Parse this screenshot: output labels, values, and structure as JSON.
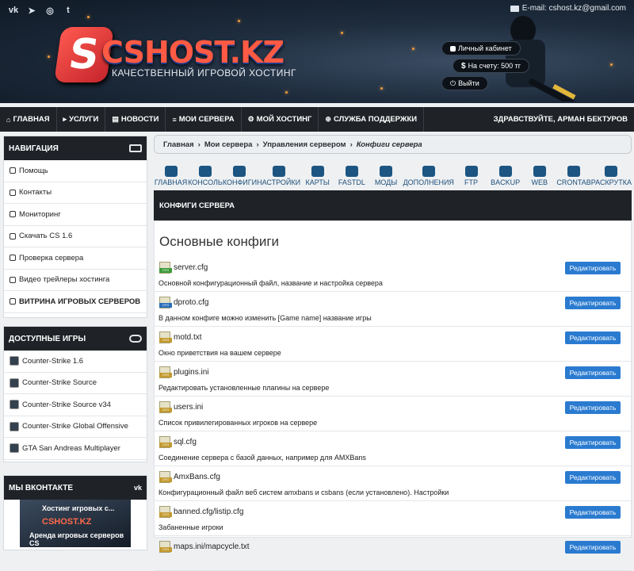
{
  "header": {
    "email": "E-mail: cshost.kz@gmail.com",
    "logo_text": "CSHOST.KZ",
    "logo_letter": "S",
    "tagline": "КАЧЕСТВЕННЫЙ ИГРОВОЙ ХОСТИНГ",
    "account": {
      "cabinet": "Личный кабинет",
      "balance": "На счету: 500 тг",
      "logout": "Выйти"
    },
    "social": [
      {
        "icon": "vk-icon",
        "glyph": "vk"
      },
      {
        "icon": "telegram-icon",
        "glyph": "➤"
      },
      {
        "icon": "instagram-icon",
        "glyph": "◎"
      },
      {
        "icon": "tumblr-icon",
        "glyph": "t"
      }
    ]
  },
  "nav": {
    "items": [
      {
        "label": "ГЛАВНАЯ",
        "icon": "home-icon",
        "glyph": "⌂"
      },
      {
        "label": "УСЛУГИ",
        "icon": "cart-icon",
        "glyph": "▸"
      },
      {
        "label": "НОВОСТИ",
        "icon": "newspaper-icon",
        "glyph": "▤"
      },
      {
        "label": "МОИ СЕРВЕРА",
        "icon": "list-icon",
        "glyph": "≡"
      },
      {
        "label": "МОЙ ХОСТИНГ",
        "icon": "cogs-icon",
        "glyph": "⚙"
      },
      {
        "label": "СЛУЖБА ПОДДЕРЖКИ",
        "icon": "lifebuoy-icon",
        "glyph": "⊕"
      }
    ],
    "greeting": "ЗДРАВСТВУЙТЕ, АРМАН БЕКТУРОВ"
  },
  "sidebar": {
    "nav_title": "НАВИГАЦИЯ",
    "nav_items": [
      {
        "label": "Помощь",
        "icon": "question-icon"
      },
      {
        "label": "Контакты",
        "icon": "phone-icon"
      },
      {
        "label": "Мониторинг",
        "icon": "monitor-icon"
      },
      {
        "label": "Скачать CS 1.6",
        "icon": "download-icon"
      },
      {
        "label": "Проверка сервера",
        "icon": "power-icon"
      },
      {
        "label": "Видео трейлеры хостинга",
        "icon": "video-icon"
      },
      {
        "label": "ВИТРИНА ИГРОВЫХ СЕРВЕРОВ",
        "icon": "gamepad-icon"
      }
    ],
    "games_title": "ДОСТУПНЫЕ ИГРЫ",
    "games": [
      {
        "label": "Counter-Strike 1.6",
        "icon": "cs16-icon"
      },
      {
        "label": "Counter-Strike Source",
        "icon": "css-icon"
      },
      {
        "label": "Counter-Strike Source v34",
        "icon": "css-v34-icon"
      },
      {
        "label": "Counter-Strike Global Offensive",
        "icon": "csgo-icon"
      },
      {
        "label": "GTA San Andreas Multiplayer",
        "icon": "samp-icon"
      }
    ],
    "vk_title": "МЫ ВКОНТАКТЕ",
    "vk_widget": {
      "title": "Хостинг игровых с...",
      "brand": "CSHOST.KZ",
      "subtitle": "Аренда игровых серверов CS"
    }
  },
  "main": {
    "breadcrumb": [
      "Главная",
      "Мои сервера",
      "Управления сервером"
    ],
    "breadcrumb_current": "Конфиги сервера",
    "tools": [
      {
        "label": "ГЛАВНАЯ",
        "icon": "home-icon"
      },
      {
        "label": "КОНСОЛЬ",
        "icon": "console-icon"
      },
      {
        "label": "КОНФИГИ",
        "icon": "configs-icon"
      },
      {
        "label": "НАСТРОЙКИ",
        "icon": "settings-icon"
      },
      {
        "label": "КАРТЫ",
        "icon": "maps-icon"
      },
      {
        "label": "FASTDL",
        "icon": "cloud-download-icon"
      },
      {
        "label": "МОДЫ",
        "icon": "mods-icon"
      },
      {
        "label": "ДОПОЛНЕНИЯ",
        "icon": "addons-icon"
      },
      {
        "label": "FTP",
        "icon": "folder-icon"
      },
      {
        "label": "BACKUP",
        "icon": "backup-icon"
      },
      {
        "label": "WEB",
        "icon": "globe-icon"
      },
      {
        "label": "CRONTAB",
        "icon": "clock-icon"
      },
      {
        "label": "РАСКРУТКА",
        "icon": "chart-icon"
      }
    ],
    "section_title": "КОНФИГИ СЕРВЕРА",
    "configs_title": "Основные конфиги",
    "edit_label": "Редактировать",
    "configs": [
      {
        "name": "server.cfg",
        "desc": "Основной конфигурационный файл, название и настройка сервера",
        "color": "#3c9a3a"
      },
      {
        "name": "dproto.cfg",
        "desc": "В данном конфиге можно изменить [Game name] название игры",
        "color": "#2a6fbb"
      },
      {
        "name": "motd.txt",
        "desc": "Окно приветствия на вашем сервере",
        "color": "#c39a2f"
      },
      {
        "name": "plugins.ini",
        "desc": "Редактировать установленные плагины на сервере",
        "color": "#c39a2f"
      },
      {
        "name": "users.ini",
        "desc": "Список привилегированных игроков на сервере",
        "color": "#c39a2f"
      },
      {
        "name": "sql.cfg",
        "desc": "Соединение сервера с базой данных, например для AMXBans",
        "color": "#c39a2f"
      },
      {
        "name": "AmxBans.cfg",
        "desc": "Конфигурационный файл веб систем amxbans и csbans (если установлено). Настройки",
        "color": "#c39a2f"
      },
      {
        "name": "banned.cfg/listip.cfg",
        "desc": "Забаненные игроки",
        "color": "#c39a2f"
      },
      {
        "name": "maps.ini/mapcycle.txt",
        "desc": "",
        "color": "#c39a2f"
      }
    ]
  }
}
